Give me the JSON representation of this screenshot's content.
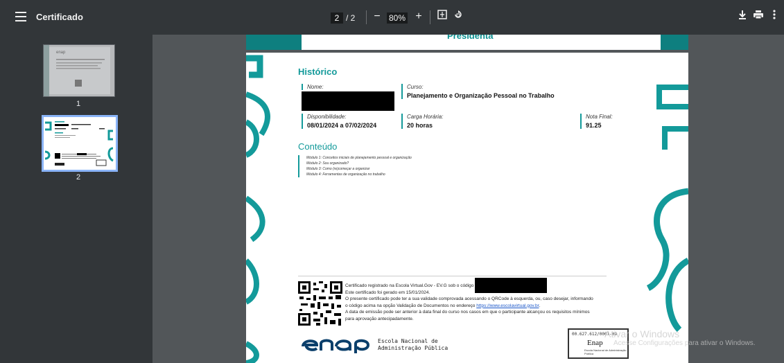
{
  "toolbar": {
    "title": "Certificado",
    "current_page": "2",
    "page_sep_total": "/  2",
    "zoom_out": "−",
    "zoom": "80%",
    "zoom_in": "+",
    "fit_icon": "fit-page-icon",
    "rotate_icon": "rotate-icon",
    "download_icon": "download-icon",
    "print_icon": "print-icon",
    "more_icon": "more-vert-icon"
  },
  "sidebar": {
    "thumbs": [
      {
        "label": "1"
      },
      {
        "label": "2"
      }
    ]
  },
  "prev_page": {
    "text": "Presidenta"
  },
  "doc": {
    "historico_title": "Histórico",
    "nome_label": "Nome:",
    "curso_label": "Curso:",
    "curso_value": "Planejamento e Organização Pessoal no Trabalho",
    "disp_label": "Disponibilidade:",
    "disp_value": "08/01/2024 a 07/02/2024",
    "carga_label": "Carga Horária:",
    "carga_value": "20 horas",
    "nota_label": "Nota Final:",
    "nota_value": "91.25",
    "conteudo_title": "Conteúdo",
    "modules": [
      "Módulo 1: Conceitos iniciais de planejamento pessoal e organização",
      "Módulo 2: Sou organizado?",
      "Módulo 3: Como (re)começar a organizar",
      "Módulo 4: Ferramentas de organização no trabalho"
    ],
    "cert_line1": "Certificado registrado na Escola Virtual.Gov - EV.G sob o código",
    "cert_line2": "Este certificado foi gerado em 15/01/2024.",
    "cert_line3": "O presente certificado pode ter a sua validade comprovada acessando o QRCode à esquerda, ou, caso desejar, informando",
    "cert_line4a": "o código acima na opção Validação de Documentos no endereço ",
    "cert_link": "https://www.escolavirtual.gov.br",
    "cert_line4b": ".",
    "cert_line5": "A data de emissão pode ser anterior à data final do curso nos casos em que o participante alcançou os requisitos mínimos",
    "cert_line6": "para aprovação antecipadamente.",
    "logo_text": "enap",
    "institution_line1": "Escola Nacional de",
    "institution_line2": "Administração Pública",
    "stamp_code": "00.627.612/0001-09",
    "stamp_name": "Enap",
    "stamp_sub1": "Escola Nacional de",
    "stamp_sub2": "Administração Pública"
  },
  "watermark": {
    "line1": "Ativar o Windows",
    "line2": "Acesse Configurações para ativar o Windows."
  },
  "colors": {
    "teal": "#139a9a",
    "toolbar": "#323639",
    "viewer_bg": "#525659"
  }
}
